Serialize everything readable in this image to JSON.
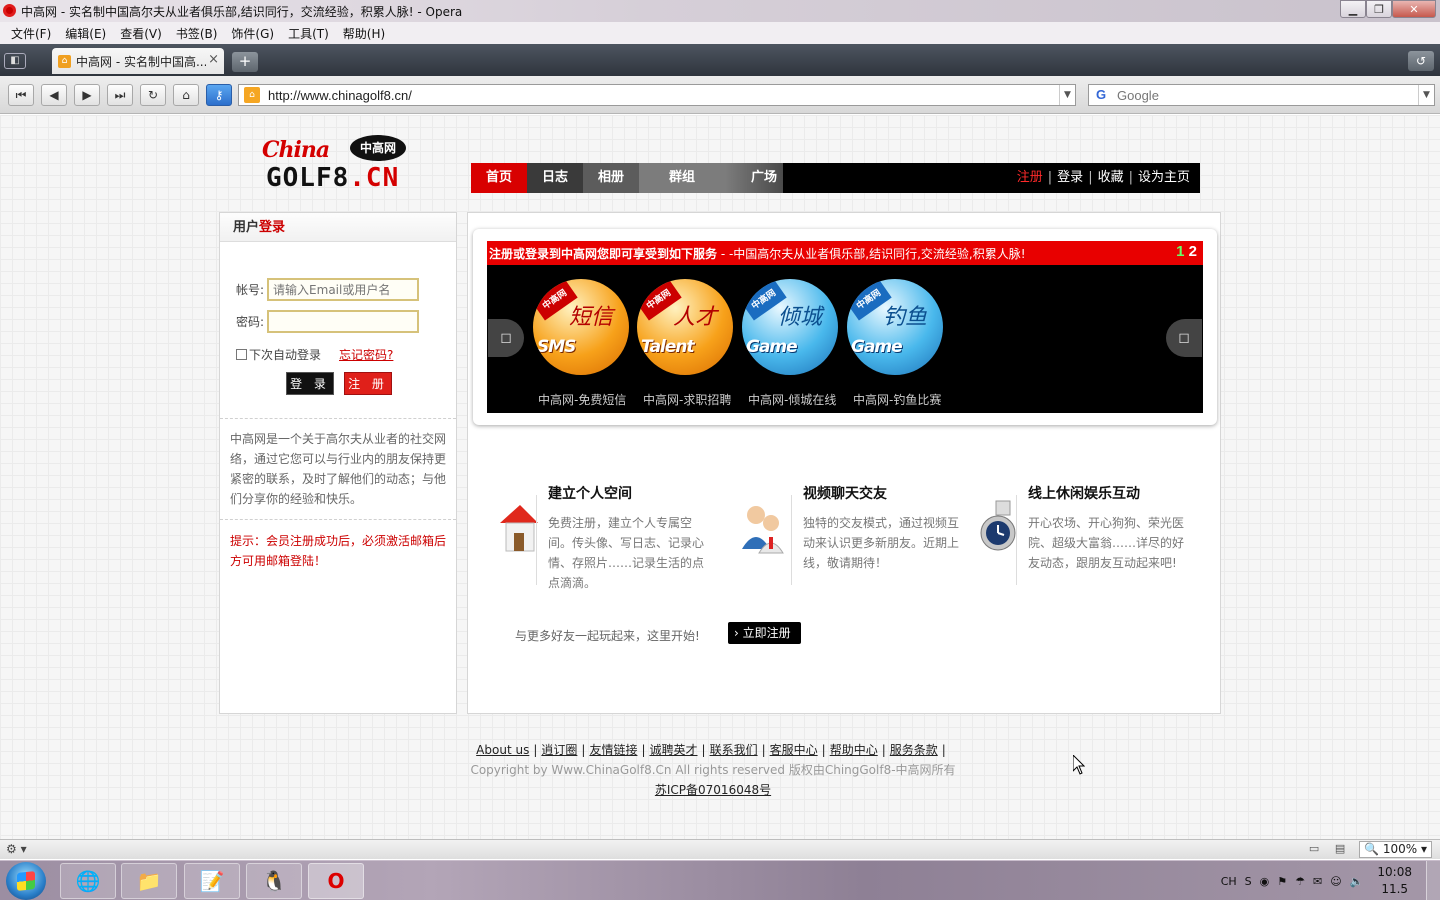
{
  "window": {
    "title": "中高网 - 实名制中国高尔夫从业者俱乐部,结识同行，交流经验，积累人脉! - Opera"
  },
  "menu": [
    "文件(F)",
    "编辑(E)",
    "查看(V)",
    "书签(B)",
    "饰件(G)",
    "工具(T)",
    "帮助(H)"
  ],
  "tab": {
    "label": "中高网 - 实名制中国高...",
    "close": "×"
  },
  "address": {
    "url": "http://www.chinagolf8.cn/"
  },
  "search": {
    "placeholder": "Google"
  },
  "logo": {
    "china": "China",
    "badge": "中高网",
    "golf": "GOLF8",
    "cn": ".CN"
  },
  "nav": {
    "items": [
      "首页",
      "日志",
      "相册",
      "群组",
      "广场"
    ],
    "register": "注册",
    "login": "登录",
    "favorite": "收藏",
    "homepage": "设为主页",
    "sep": "|"
  },
  "login": {
    "title_plain": "用户",
    "title_red": "登录",
    "account_label": "帐号:",
    "account_placeholder": "请输入Email或用户名",
    "password_label": "密码:",
    "remember": "下次自动登录",
    "forgot": "忘记密码?",
    "login_button": "登 录",
    "register_button": "注 册",
    "description": "中高网是一个关于高尔夫从业者的社交网络，通过它您可以与行业内的朋友保持更紧密的联系，及时了解他们的动态；与他们分享你的经验和快乐。",
    "tip": "提示：会员注册成功后，必须激活邮箱后方可用邮箱登陆！"
  },
  "slider": {
    "bar_text": "注册或登录到中高网您即可享受到如下服务",
    "bar_text_tail": " - -中国高尔夫从业者俱乐部,结识同行,交流经验,积累人脉!",
    "page_current": "1",
    "page_other": "2",
    "services": [
      {
        "tag": "中高网",
        "word": "短信",
        "en": "SMS",
        "caption": "中高网-免费短信",
        "color": "orange"
      },
      {
        "tag": "中高网",
        "word": "人才",
        "en": "Talent",
        "caption": "中高网-求职招聘",
        "color": "orange"
      },
      {
        "tag": "中高网",
        "word": "倾城",
        "en": "Game",
        "caption": "中高网-倾城在线",
        "color": "blue"
      },
      {
        "tag": "中高网",
        "word": "钓鱼",
        "en": "Game",
        "caption": "中高网-钓鱼比赛",
        "color": "blue"
      }
    ]
  },
  "features": [
    {
      "title": "建立个人空间",
      "text": "免费注册，建立个人专属空间。传头像、写日志、记录心情、存照片……记录生活的点点滴滴。"
    },
    {
      "title": "视频聊天交友",
      "text": "独特的交友模式，通过视频互动来认识更多新朋友。近期上线，敬请期待！"
    },
    {
      "title": "线上休闲娱乐互动",
      "text": "开心农场、开心狗狗、荣光医院、超级大富翁……详尽的好友动态，跟朋友互动起来吧!"
    }
  ],
  "join": {
    "text": "与更多好友一起玩起来，这里开始!",
    "button": "立即注册"
  },
  "footer": {
    "links": [
      "About us",
      "逍订圈",
      "友情链接",
      "诚聘英才",
      "联系我们",
      "客服中心",
      "帮助中心",
      "服务条款"
    ],
    "copyright": "Copyright by Www.ChinaGolf8.Cn All rights reserved 版权由ChingGolf8-中高网所有",
    "icp": "苏ICP备07016048号"
  },
  "statusbar": {
    "zoom": "100%"
  },
  "taskbar": {
    "ime": "CH",
    "time": "10:08",
    "date": "11.5"
  }
}
